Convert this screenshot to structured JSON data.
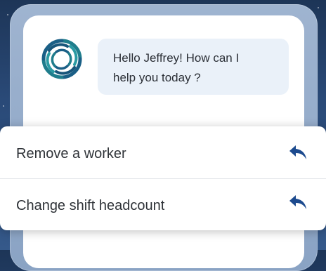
{
  "chat": {
    "greeting_line1": "Hello Jeffrey! How can I",
    "greeting_line2": "help you today ?"
  },
  "actions": [
    {
      "label": "Remove a worker",
      "icon": "reply-arrow-icon"
    },
    {
      "label": "Change shift headcount",
      "icon": "reply-arrow-icon"
    }
  ],
  "colors": {
    "background": "#1d3557",
    "bubble": "#eaf1f9",
    "accent_navy": "#1c4a8e",
    "logo_teal": "#1f7d8c"
  }
}
